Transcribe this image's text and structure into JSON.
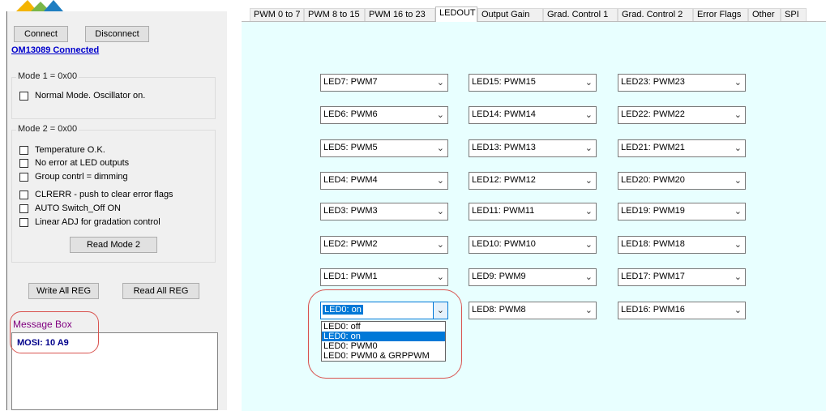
{
  "connection": {
    "connect_label": "Connect",
    "disconnect_label": "Disconnect",
    "status_link": "OM13089 Connected"
  },
  "mode1": {
    "title": "Mode 1 = 0x00",
    "options": [
      "Normal Mode. Oscillator on."
    ]
  },
  "mode2": {
    "title": "Mode 2 = 0x00",
    "options": [
      "Temperature O.K.",
      "No error at LED outputs",
      "Group contrl = dimming",
      "CLRERR - push to clear error flags",
      "AUTO Switch_Off ON",
      "Linear ADJ for gradation control"
    ],
    "read_label": "Read Mode 2"
  },
  "registers": {
    "write_all_label": "Write All REG",
    "read_all_label": "Read All REG"
  },
  "message_box": {
    "label": "Message Box",
    "lines": [
      "MOSI: 10 A9"
    ]
  },
  "tabs": [
    {
      "label": "PWM 0 to 7",
      "active": false
    },
    {
      "label": "PWM 8 to 15",
      "active": false
    },
    {
      "label": "PWM 16 to 23",
      "active": false
    },
    {
      "label": "LEDOUT",
      "active": true
    },
    {
      "label": "Output Gain",
      "active": false
    },
    {
      "label": "Grad. Control 1",
      "active": false
    },
    {
      "label": "Grad. Control 2",
      "active": false
    },
    {
      "label": "Error Flags",
      "active": false
    },
    {
      "label": "Other",
      "active": false
    },
    {
      "label": "SPI",
      "active": false
    }
  ],
  "ledout": {
    "column1": [
      "LED7: PWM7",
      "LED6: PWM6",
      "LED5: PWM5",
      "LED4: PWM4",
      "LED3: PWM3",
      "LED2: PWM2",
      "LED1: PWM1",
      "LED0: on"
    ],
    "column2": [
      "LED15: PWM15",
      "LED14: PWM14",
      "LED13: PWM13",
      "LED12: PWM12",
      "LED11: PWM11",
      "LED10: PWM10",
      "LED9: PWM9",
      "LED8: PWM8"
    ],
    "column3": [
      "LED23: PWM23",
      "LED22: PWM22",
      "LED21: PWM21",
      "LED20: PWM20",
      "LED19: PWM19",
      "LED18: PWM18",
      "LED17: PWM17",
      "LED16: PWM16"
    ],
    "led0_dropdown": {
      "options": [
        "LED0: off",
        "LED0: on",
        "LED0: PWM0",
        "LED0: PWM0 & GRPPWM"
      ],
      "selected_index": 1
    }
  },
  "icons": {
    "chevron": "chevron-down-icon",
    "check": "checkbox-unchecked"
  },
  "colors": {
    "content_bg": "#e8ffff",
    "highlight": "#0078d7",
    "annotation": "#d9534f",
    "message_label": "#800080"
  }
}
